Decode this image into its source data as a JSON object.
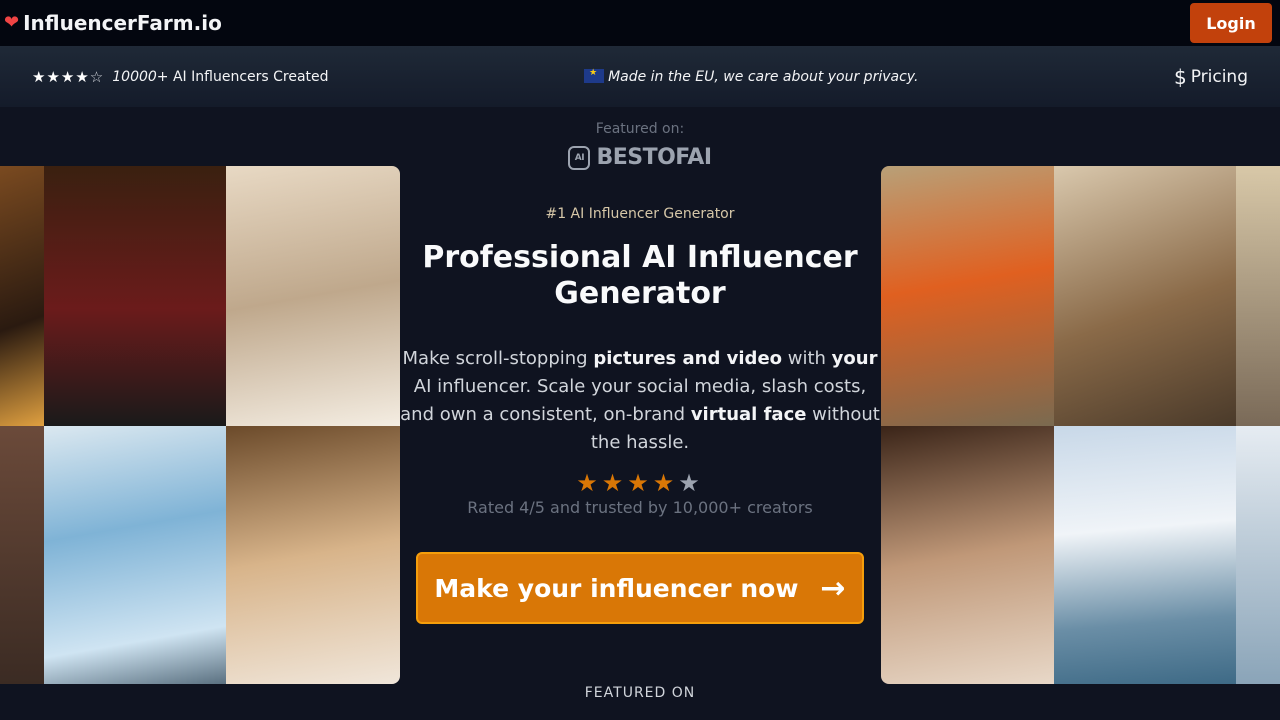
{
  "nav": {
    "brand": "InfluencerFarm.io",
    "login_label": "Login"
  },
  "infobar": {
    "rating_stars": 4,
    "rating_max": 5,
    "influencers_count": "10000+",
    "influencers_text": "AI Influencers Created",
    "eu_text": "Made in the EU, we care about your privacy.",
    "pricing_label": "Pricing"
  },
  "hero": {
    "featured_on": "Featured on:",
    "featured_logo_badge": "AI",
    "featured_logo_text": "BESTOFAI",
    "tagline": "#1 AI Influencer Generator",
    "title": "Professional AI Influencer Generator",
    "desc_1": "Make scroll-stopping ",
    "desc_b1": "pictures and video",
    "desc_2": " with ",
    "desc_b2": "your",
    "desc_3": " AI influencer. Scale your social media, slash costs, and own a consistent, on-brand ",
    "desc_b3": "virtual face",
    "desc_4": " without the hassle.",
    "rating_stars": 4,
    "rating_max": 5,
    "rated_text": "Rated 4/5 and trusted by 10,000+ creators",
    "cta_label": "Make your influencer now"
  },
  "footer": {
    "featured_on": "FEATURED ON"
  },
  "colors": {
    "accent": "#d97706",
    "login": "#c2410c",
    "heart": "#ef4444"
  },
  "icons": [
    "heart-icon",
    "star-icon",
    "eu-flag-icon",
    "dollar-icon",
    "arrow-right-icon"
  ]
}
